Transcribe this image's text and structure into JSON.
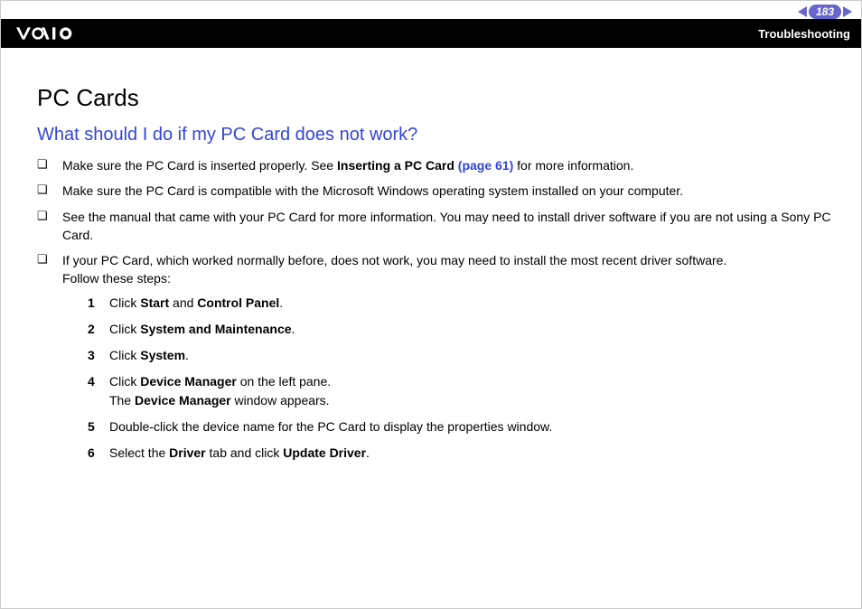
{
  "header": {
    "page_number": "183",
    "section": "Troubleshooting",
    "logo_alt": "VAIO"
  },
  "content": {
    "title": "PC Cards",
    "subtitle": "What should I do if my PC Card does not work?",
    "bullets": {
      "b1_pre": "Make sure the PC Card is inserted properly. See ",
      "b1_bold": "Inserting a PC Card",
      "b1_link": " (page 61)",
      "b1_post": " for more information.",
      "b2": "Make sure the PC Card is compatible with the Microsoft Windows operating system installed on your computer.",
      "b3": "See the manual that came with your PC Card for more information. You may need to install driver software if you are not using a Sony PC Card.",
      "b4_line1": "If your PC Card, which worked normally before, does not work, you may need to install the most recent driver software.",
      "b4_line2": "Follow these steps:"
    },
    "steps": {
      "s1_n": "1",
      "s1_a": "Click ",
      "s1_b1": "Start",
      "s1_c": " and ",
      "s1_b2": "Control Panel",
      "s1_d": ".",
      "s2_n": "2",
      "s2_a": "Click ",
      "s2_b1": "System and Maintenance",
      "s2_c": ".",
      "s3_n": "3",
      "s3_a": "Click ",
      "s3_b1": "System",
      "s3_c": ".",
      "s4_n": "4",
      "s4_a": "Click ",
      "s4_b1": "Device Manager",
      "s4_c": " on the left pane.",
      "s4_line2a": "The ",
      "s4_line2b": "Device Manager",
      "s4_line2c": " window appears.",
      "s5_n": "5",
      "s5_a": "Double-click the device name for the PC Card to display the properties window.",
      "s6_n": "6",
      "s6_a": "Select the ",
      "s6_b1": "Driver",
      "s6_c": " tab and click ",
      "s6_b2": "Update Driver",
      "s6_d": "."
    }
  }
}
